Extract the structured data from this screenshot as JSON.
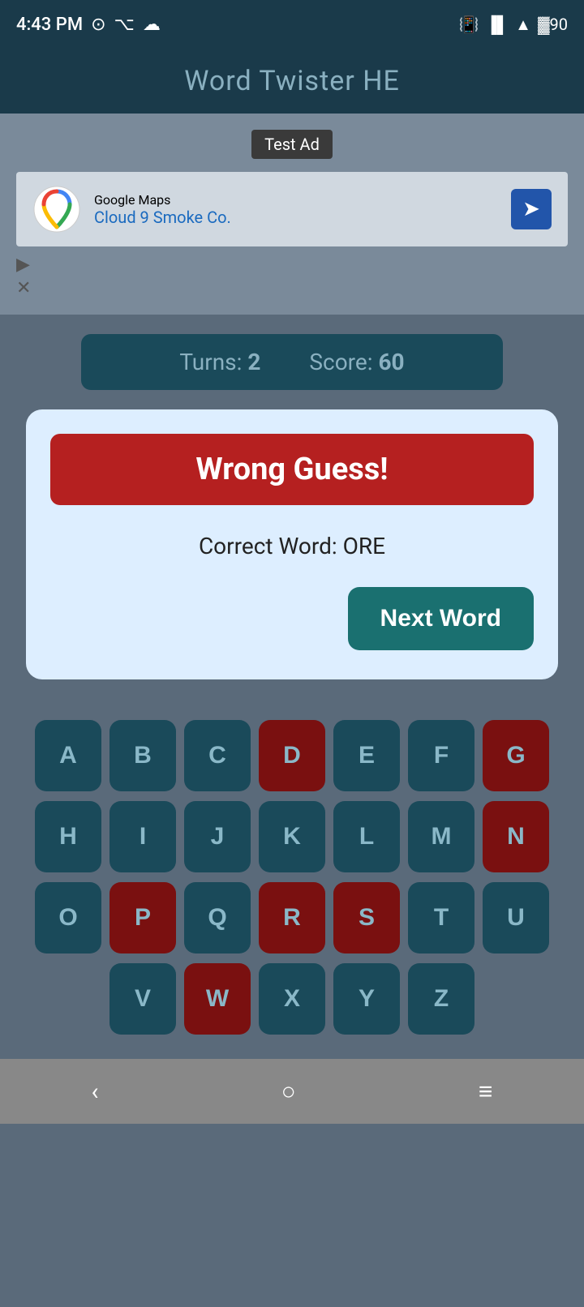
{
  "statusBar": {
    "time": "4:43 PM",
    "icons": [
      "whatsapp",
      "usb",
      "cloud",
      "vibrate",
      "signal",
      "wifi",
      "battery"
    ]
  },
  "header": {
    "title": "Word Twister HE"
  },
  "ad": {
    "label": "Test Ad",
    "company": "Google Maps",
    "subtitle": "Cloud 9 Smoke Co."
  },
  "scoreBar": {
    "turnsLabel": "Turns:",
    "turnsValue": "2",
    "scoreLabel": "Score:",
    "scoreValue": "60"
  },
  "modal": {
    "wrongGuessLabel": "Wrong Guess!",
    "correctWordLabel": "Correct Word: ORE",
    "nextWordButton": "Next Word"
  },
  "keyboard": {
    "rows": [
      [
        "A",
        "B",
        "C",
        "D",
        "E",
        "F",
        "G"
      ],
      [
        "H",
        "I",
        "J",
        "K",
        "L",
        "M",
        "N"
      ],
      [
        "O",
        "P",
        "Q",
        "R",
        "S",
        "T",
        "U"
      ],
      [
        "V",
        "W",
        "X",
        "Y",
        "Z"
      ]
    ],
    "usedKeys": [
      "D",
      "G",
      "N",
      "P",
      "R",
      "S",
      "W"
    ]
  },
  "navBar": {
    "back": "‹",
    "home": "○",
    "menu": "≡"
  }
}
